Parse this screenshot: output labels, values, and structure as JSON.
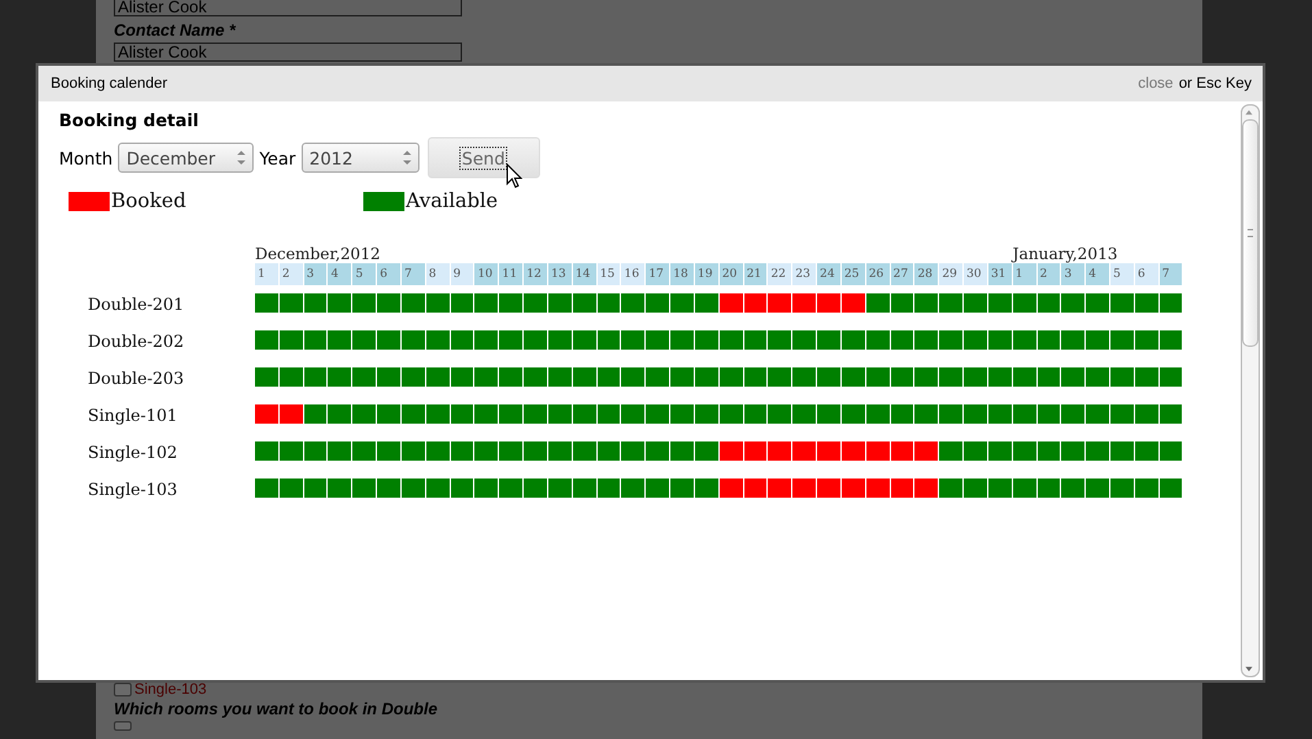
{
  "background_form": {
    "top_field_value": "Alister Cook",
    "contact_label": "Contact Name *",
    "contact_value": "Alister Cook",
    "room_option": {
      "label": "Single-103",
      "checked": false
    },
    "question": "Which rooms you want to book in Double",
    "double_option": {
      "checked": false
    }
  },
  "dialog": {
    "title": "Booking calender",
    "close_link": "close",
    "close_hint": "or Esc Key",
    "heading": "Booking detail",
    "month_label": "Month",
    "month_value": "December",
    "year_label": "Year",
    "year_value": "2012",
    "send_button": "Send",
    "legend": [
      {
        "label": "Booked",
        "color": "#ff0000"
      },
      {
        "label": "Available",
        "color": "#008000"
      }
    ],
    "days": [
      {
        "label": "1",
        "weekend": true,
        "month": "December,2012"
      },
      {
        "label": "2",
        "weekend": true
      },
      {
        "label": "3",
        "weekend": false
      },
      {
        "label": "4",
        "weekend": false
      },
      {
        "label": "5",
        "weekend": false
      },
      {
        "label": "6",
        "weekend": false
      },
      {
        "label": "7",
        "weekend": false
      },
      {
        "label": "8",
        "weekend": true
      },
      {
        "label": "9",
        "weekend": true
      },
      {
        "label": "10",
        "weekend": false
      },
      {
        "label": "11",
        "weekend": false
      },
      {
        "label": "12",
        "weekend": false
      },
      {
        "label": "13",
        "weekend": false
      },
      {
        "label": "14",
        "weekend": false
      },
      {
        "label": "15",
        "weekend": true
      },
      {
        "label": "16",
        "weekend": true
      },
      {
        "label": "17",
        "weekend": false
      },
      {
        "label": "18",
        "weekend": false
      },
      {
        "label": "19",
        "weekend": false
      },
      {
        "label": "20",
        "weekend": false
      },
      {
        "label": "21",
        "weekend": false
      },
      {
        "label": "22",
        "weekend": true
      },
      {
        "label": "23",
        "weekend": true
      },
      {
        "label": "24",
        "weekend": false
      },
      {
        "label": "25",
        "weekend": false
      },
      {
        "label": "26",
        "weekend": false
      },
      {
        "label": "27",
        "weekend": false
      },
      {
        "label": "28",
        "weekend": false
      },
      {
        "label": "29",
        "weekend": true
      },
      {
        "label": "30",
        "weekend": true
      },
      {
        "label": "31",
        "weekend": false
      },
      {
        "label": "1",
        "weekend": false,
        "month": "January,2013"
      },
      {
        "label": "2",
        "weekend": false
      },
      {
        "label": "3",
        "weekend": false
      },
      {
        "label": "4",
        "weekend": false
      },
      {
        "label": "5",
        "weekend": true
      },
      {
        "label": "6",
        "weekend": true
      },
      {
        "label": "7",
        "weekend": false
      }
    ],
    "rooms": [
      {
        "name": "Double-201",
        "booked": [
          false,
          false,
          false,
          false,
          false,
          false,
          false,
          false,
          false,
          false,
          false,
          false,
          false,
          false,
          false,
          false,
          false,
          false,
          false,
          true,
          true,
          true,
          true,
          true,
          true,
          false,
          false,
          false,
          false,
          false,
          false,
          false,
          false,
          false,
          false,
          false,
          false,
          false
        ]
      },
      {
        "name": "Double-202",
        "booked": [
          false,
          false,
          false,
          false,
          false,
          false,
          false,
          false,
          false,
          false,
          false,
          false,
          false,
          false,
          false,
          false,
          false,
          false,
          false,
          false,
          false,
          false,
          false,
          false,
          false,
          false,
          false,
          false,
          false,
          false,
          false,
          false,
          false,
          false,
          false,
          false,
          false,
          false
        ]
      },
      {
        "name": "Double-203",
        "booked": [
          false,
          false,
          false,
          false,
          false,
          false,
          false,
          false,
          false,
          false,
          false,
          false,
          false,
          false,
          false,
          false,
          false,
          false,
          false,
          false,
          false,
          false,
          false,
          false,
          false,
          false,
          false,
          false,
          false,
          false,
          false,
          false,
          false,
          false,
          false,
          false,
          false,
          false
        ]
      },
      {
        "name": "Single-101",
        "booked": [
          true,
          true,
          false,
          false,
          false,
          false,
          false,
          false,
          false,
          false,
          false,
          false,
          false,
          false,
          false,
          false,
          false,
          false,
          false,
          false,
          false,
          false,
          false,
          false,
          false,
          false,
          false,
          false,
          false,
          false,
          false,
          false,
          false,
          false,
          false,
          false,
          false,
          false
        ]
      },
      {
        "name": "Single-102",
        "booked": [
          false,
          false,
          false,
          false,
          false,
          false,
          false,
          false,
          false,
          false,
          false,
          false,
          false,
          false,
          false,
          false,
          false,
          false,
          false,
          true,
          true,
          true,
          true,
          true,
          true,
          true,
          true,
          true,
          false,
          false,
          false,
          false,
          false,
          false,
          false,
          false,
          false,
          false
        ]
      },
      {
        "name": "Single-103",
        "booked": [
          false,
          false,
          false,
          false,
          false,
          false,
          false,
          false,
          false,
          false,
          false,
          false,
          false,
          false,
          false,
          false,
          false,
          false,
          false,
          true,
          true,
          true,
          true,
          true,
          true,
          true,
          true,
          true,
          false,
          false,
          false,
          false,
          false,
          false,
          false,
          false,
          false,
          false
        ]
      }
    ]
  }
}
